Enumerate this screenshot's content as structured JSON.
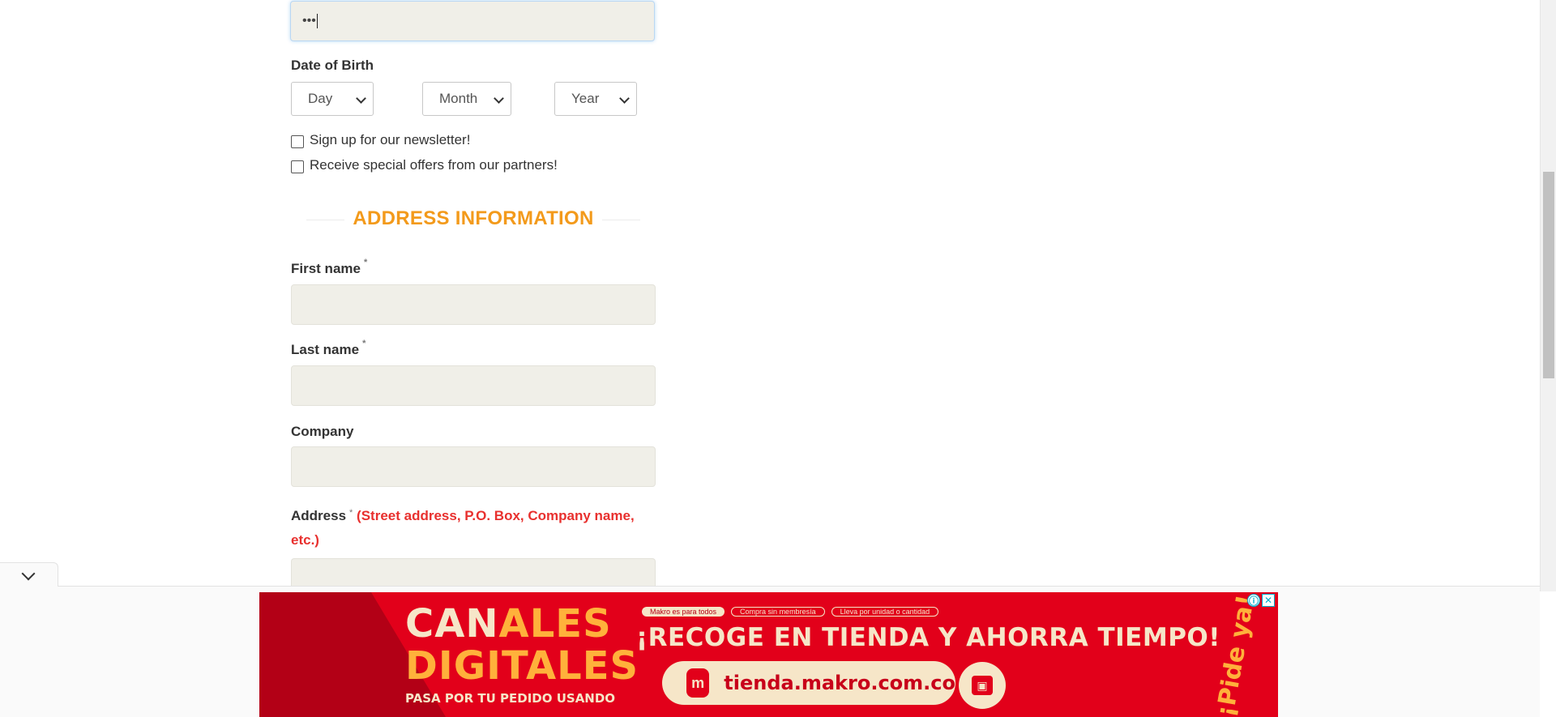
{
  "form": {
    "password_value": "•••",
    "dob_label": "Date of Birth",
    "dob": {
      "day": "Day",
      "month": "Month",
      "year": "Year"
    },
    "newsletter_label": "Sign up for our newsletter!",
    "offers_label": "Receive special offers from our partners!",
    "section_title": "ADDRESS INFORMATION",
    "required_mark": "*",
    "first_name_label": "First name",
    "last_name_label": "Last name",
    "company_label": "Company",
    "address_label": "Address",
    "address_hint": "(Street address, P.O. Box, Company name, etc.)"
  },
  "ad": {
    "brand_line1_a": "CAN",
    "brand_line1_b": "ALES",
    "brand_line2_a": "DIGIT",
    "brand_line2_b": "ALES",
    "brand_small": "PASA POR TU PEDIDO USANDO",
    "tag1": "Makro es para todos",
    "tag2": "Compra sin membresía",
    "tag3": "Lleva por unidad o cantidad",
    "headline": "¡RECOGE EN TIENDA Y AHORRA TIEMPO!",
    "logo_letter": "m",
    "url": "tienda.makro.com.co",
    "side_text": "¡Pide ya!",
    "info_icon": "ⓘ",
    "close_icon": "✕",
    "cart_icon": "cart-icon",
    "brand_colors": {
      "red": "#e2001a",
      "cream": "#f6e6c8",
      "orange": "#ffb13b"
    }
  },
  "colors": {
    "section_title": "#f39a1b",
    "hint_red": "#e8302e",
    "input_bg": "#f0efe8"
  }
}
